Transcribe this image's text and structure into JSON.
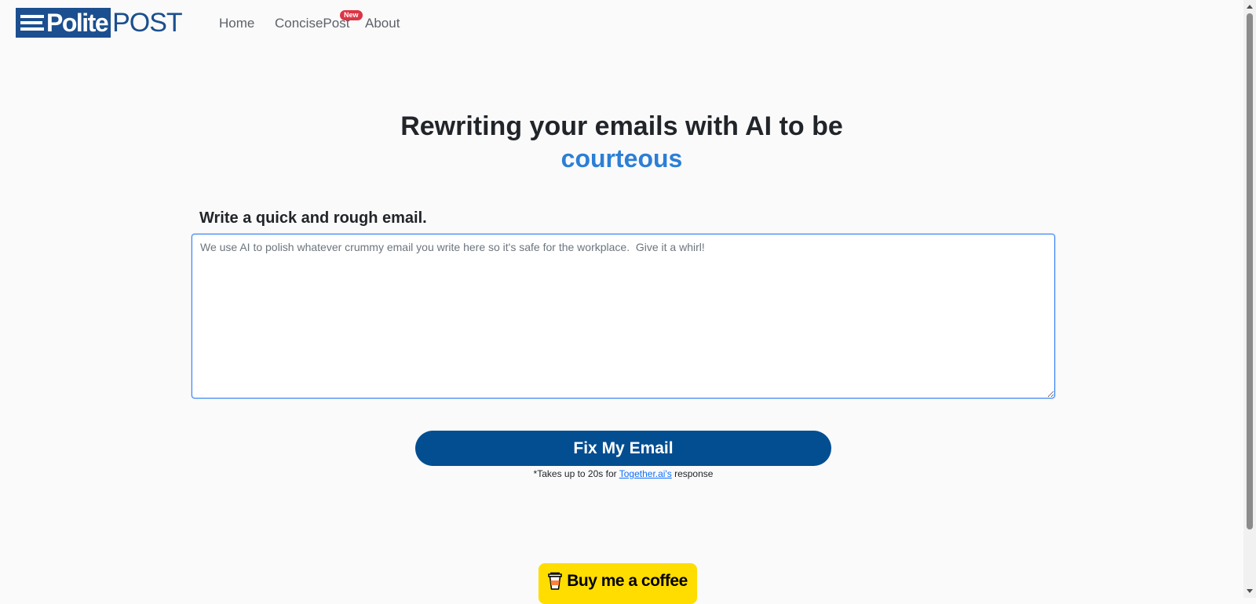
{
  "brand": {
    "logo_polite": "Polite",
    "logo_post": "POST"
  },
  "nav": {
    "items": [
      {
        "label": "Home"
      },
      {
        "label": "ConcisePost",
        "badge": "New"
      },
      {
        "label": "About"
      }
    ]
  },
  "hero": {
    "title": "Rewriting your emails with AI to be",
    "highlight": "courteous"
  },
  "form": {
    "label": "Write a quick and rough email.",
    "placeholder": "We use AI to polish whatever crummy email you write here so it's safe for the workplace.  Give it a whirl!",
    "value": ""
  },
  "submit": {
    "label": "Fix My Email",
    "note_prefix": "*Takes up to 20s for ",
    "note_link": "Together.ai's",
    "note_suffix": " response"
  },
  "coffee": {
    "label": "Buy me a coffee"
  },
  "colors": {
    "brand_blue": "#1b4f8f",
    "highlight_blue": "#2b7fd6",
    "button_blue": "#024e91",
    "badge_red": "#dc3545",
    "coffee_yellow": "#ffdd00"
  }
}
